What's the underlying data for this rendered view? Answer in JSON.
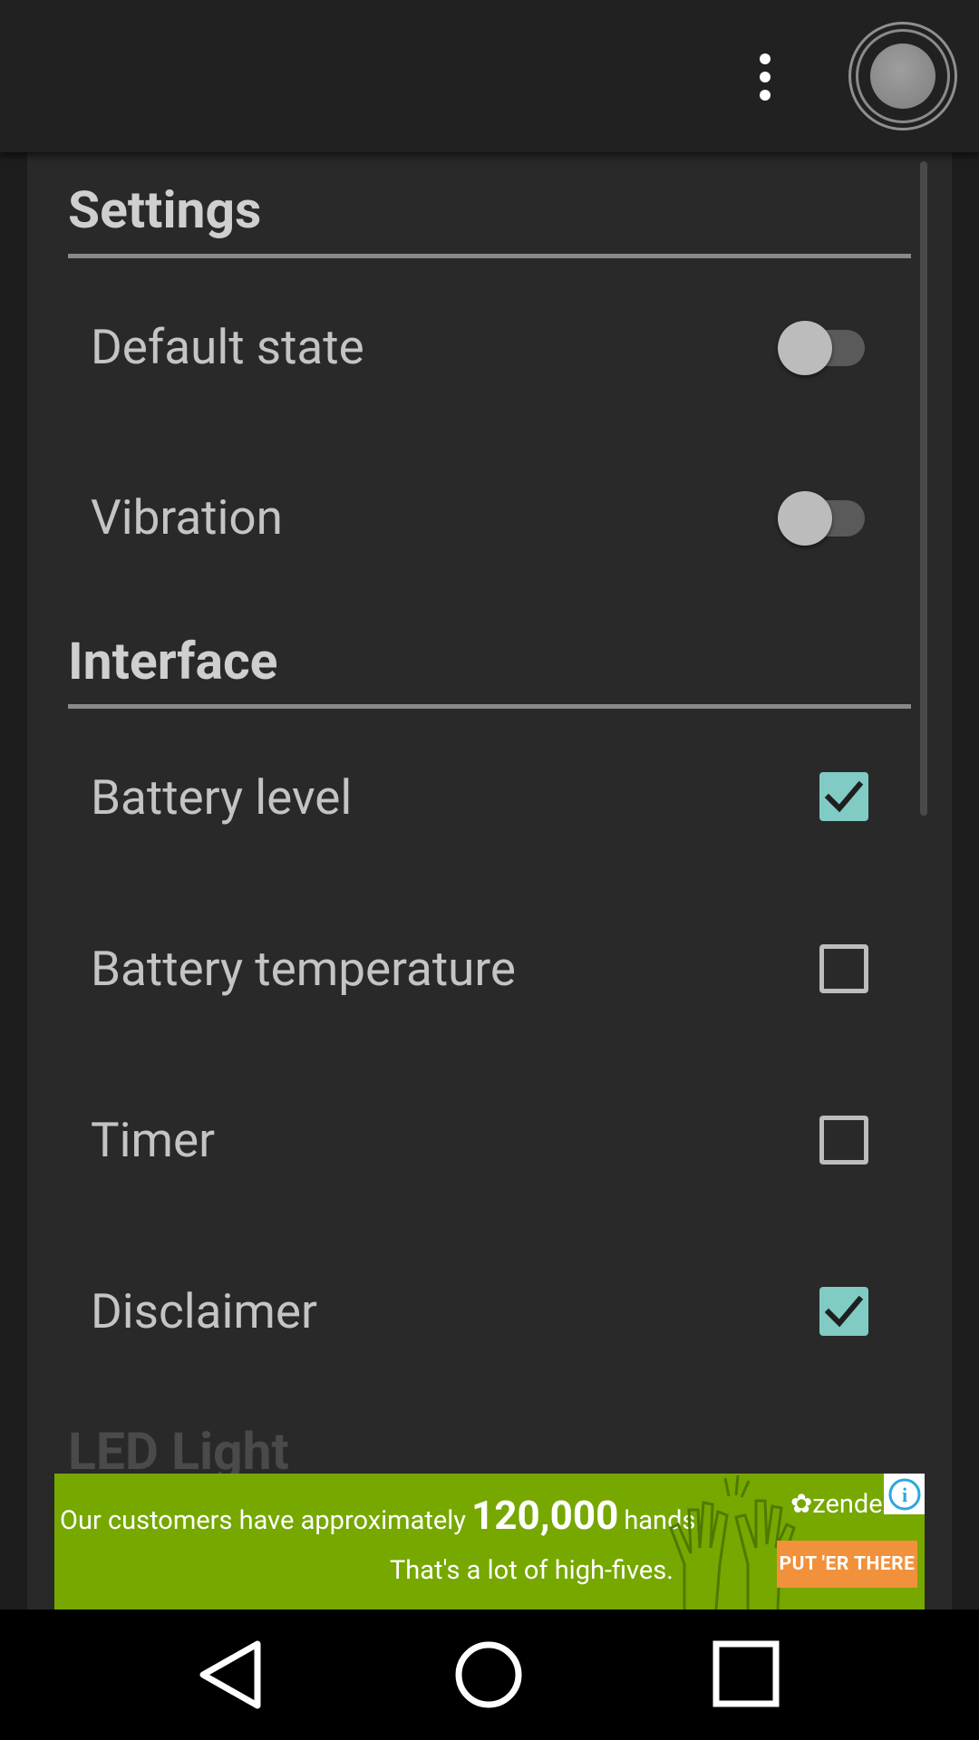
{
  "appbar": {
    "overflow_menu": "more-vert-icon",
    "power_button": "power-toggle-icon"
  },
  "settings_section": {
    "title": "Settings",
    "items": [
      {
        "label": "Default state",
        "control": "switch",
        "on": false
      },
      {
        "label": "Vibration",
        "control": "switch",
        "on": false
      }
    ]
  },
  "interface_section": {
    "title": "Interface",
    "items": [
      {
        "label": "Battery level",
        "control": "checkbox",
        "checked": true
      },
      {
        "label": "Battery temperature",
        "control": "checkbox",
        "checked": false
      },
      {
        "label": "Timer",
        "control": "checkbox",
        "checked": false
      },
      {
        "label": "Disclaimer",
        "control": "checkbox",
        "checked": true
      }
    ]
  },
  "next_section": {
    "title": "LED Light"
  },
  "ad": {
    "line1_prefix": "Our customers have approximately",
    "line1_number": "120,000",
    "line1_suffix": "hands.",
    "line2": "That's a lot of high-fives.",
    "brand": "✿zendesk",
    "cta": "PUT 'ER THERE",
    "info": "i",
    "background": "#76a800",
    "cta_color": "#f1913b"
  },
  "navbar": {
    "back": "back-triangle-icon",
    "home": "home-circle-icon",
    "recents": "recents-square-icon"
  },
  "colors": {
    "accent": "#80cbc4",
    "panel": "#292929",
    "appbar": "#212121"
  }
}
